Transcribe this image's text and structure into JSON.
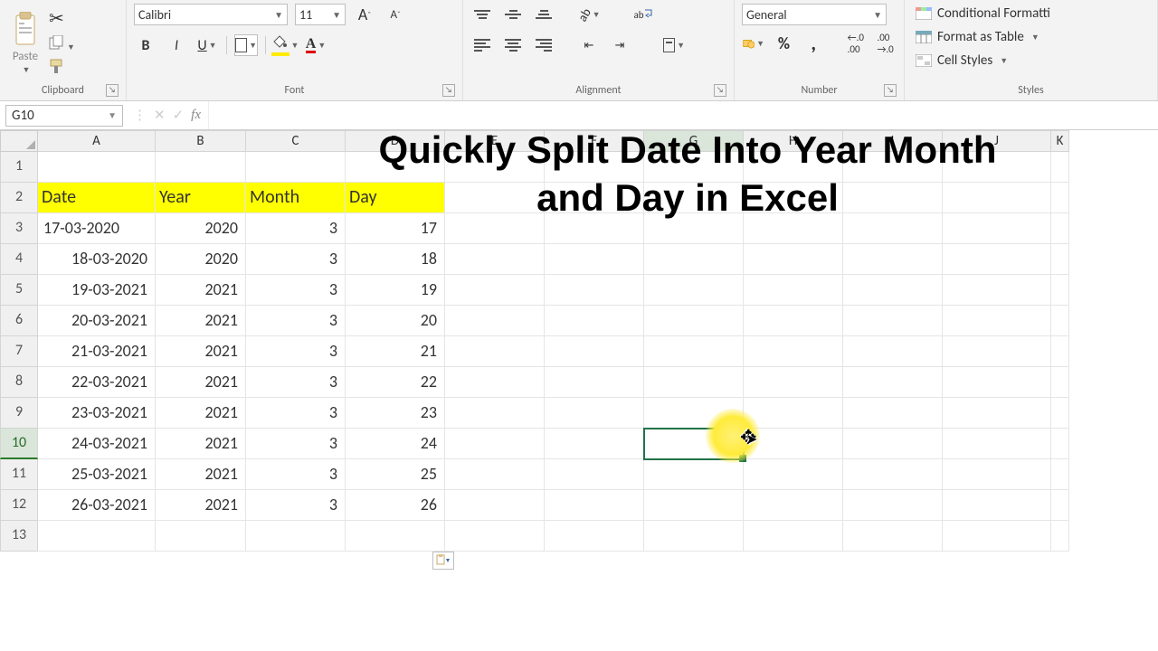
{
  "ribbon": {
    "clipboard": {
      "paste": "Paste",
      "label": "Clipboard"
    },
    "font": {
      "name": "Calibri",
      "size": "11",
      "bold": "B",
      "italic": "I",
      "underline": "U",
      "label": "Font"
    },
    "alignment": {
      "wrap": "ab",
      "label": "Alignment"
    },
    "number": {
      "format": "General",
      "pct": "%",
      "comma": ",",
      "inc": ".0 .00",
      "dec": ".00 .0",
      "label": "Number"
    },
    "styles": {
      "cond": "Conditional Formatti",
      "table": "Format as Table",
      "cell": "Cell Styles",
      "label": "Styles"
    }
  },
  "fx": {
    "namebox": "G10",
    "fx": "fx"
  },
  "overlay": {
    "line1": "Quickly Split Date Into Year Month",
    "line2": "and Day in Excel"
  },
  "columns": [
    "A",
    "B",
    "C",
    "D",
    "E",
    "F",
    "G",
    "H",
    "I",
    "J",
    "K"
  ],
  "headers": {
    "A": "Date",
    "B": "Year",
    "C": "Month",
    "D": "Day"
  },
  "rows": [
    {
      "n": "1"
    },
    {
      "n": "2",
      "hdr": true
    },
    {
      "n": "3",
      "A": "17-03-2020",
      "B": "2020",
      "C": "3",
      "D": "17"
    },
    {
      "n": "4",
      "A": "18-03-2020",
      "B": "2020",
      "C": "3",
      "D": "18"
    },
    {
      "n": "5",
      "A": "19-03-2021",
      "B": "2021",
      "C": "3",
      "D": "19"
    },
    {
      "n": "6",
      "A": "20-03-2021",
      "B": "2021",
      "C": "3",
      "D": "20"
    },
    {
      "n": "7",
      "A": "21-03-2021",
      "B": "2021",
      "C": "3",
      "D": "21"
    },
    {
      "n": "8",
      "A": "22-03-2021",
      "B": "2021",
      "C": "3",
      "D": "22"
    },
    {
      "n": "9",
      "A": "23-03-2021",
      "B": "2021",
      "C": "3",
      "D": "23"
    },
    {
      "n": "10",
      "A": "24-03-2021",
      "B": "2021",
      "C": "3",
      "D": "24"
    },
    {
      "n": "11",
      "A": "25-03-2021",
      "B": "2021",
      "C": "3",
      "D": "25"
    },
    {
      "n": "12",
      "A": "26-03-2021",
      "B": "2021",
      "C": "3",
      "D": "26"
    },
    {
      "n": "13"
    }
  ]
}
